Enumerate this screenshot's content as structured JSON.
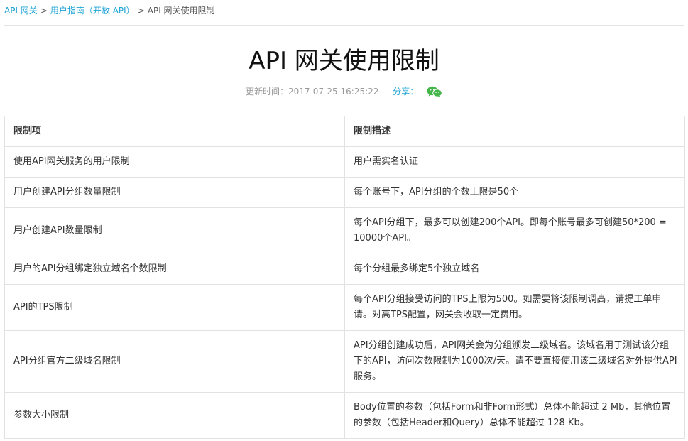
{
  "breadcrumb": {
    "items": [
      "API 网关",
      "用户指南（开放 API）",
      "API 网关使用限制"
    ],
    "separator": ">"
  },
  "page": {
    "title": "API 网关使用限制",
    "updated": "更新时间：2017-07-25 16:25:22",
    "share_label": "分享："
  },
  "table": {
    "headers": [
      "限制项",
      "限制描述"
    ],
    "rows": [
      [
        "使用API网关服务的用户限制",
        "用户需实名认证"
      ],
      [
        "用户创建API分组数量限制",
        "每个账号下，API分组的个数上限是50个"
      ],
      [
        "用户创建API数量限制",
        "每个API分组下，最多可以创建200个API。即每个账号最多可创建50*200 = 10000个API。"
      ],
      [
        "用户的API分组绑定独立域名个数限制",
        "每个分组最多绑定5个独立域名"
      ],
      [
        "API的TPS限制",
        "每个API分组接受访问的TPS上限为500。如需要将该限制调高，请提工单申请。对高TPS配置，网关会收取一定费用。"
      ],
      [
        "API分组官方二级域名限制",
        "API分组创建成功后，API网关会为分组颁发二级域名。该域名用于测试该分组下的API，访问次数限制为1000次/天。请不要直接使用该二级域名对外提供API服务。"
      ],
      [
        "参数大小限制",
        "Body位置的参数（包括Form和非Form形式）总体不能超过 2 Mb，其他位置的参数（包括Header和Query）总体不能超过 128 Kb。"
      ]
    ]
  },
  "colors": {
    "link": "#1fa4d6",
    "wechat": "#44b549"
  }
}
